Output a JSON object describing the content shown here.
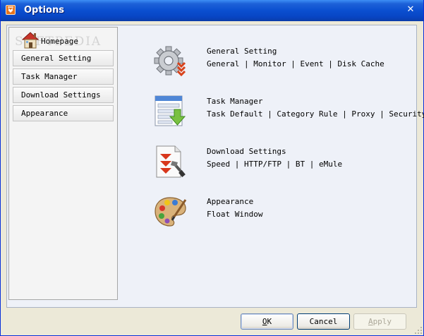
{
  "window": {
    "title": "Options"
  },
  "watermark": "SOFTPEDIA",
  "sidebar": {
    "home": {
      "label": "Homepage",
      "icon": "house-icon"
    },
    "items": [
      {
        "label": "General Setting"
      },
      {
        "label": "Task Manager"
      },
      {
        "label": "Download Settings"
      },
      {
        "label": "Appearance"
      }
    ]
  },
  "sections": [
    {
      "title": "General Setting",
      "icon": "gear-icon",
      "links": [
        "General",
        "Monitor",
        "Event",
        "Disk Cache"
      ]
    },
    {
      "title": "Task Manager",
      "icon": "task-list-icon",
      "links": [
        "Task Default",
        "Category Rule",
        "Proxy",
        "Security"
      ]
    },
    {
      "title": "Download Settings",
      "icon": "download-tools-icon",
      "links": [
        "Speed",
        "HTTP/FTP",
        "BT",
        "eMule"
      ]
    },
    {
      "title": "Appearance",
      "icon": "palette-icon",
      "links": [
        "Float Window"
      ]
    }
  ],
  "separator": "|",
  "buttons": {
    "ok": {
      "label": "OK",
      "mnemonic": "O",
      "rest": "K"
    },
    "cancel": {
      "label": "Cancel"
    },
    "apply": {
      "label": "Apply",
      "mnemonic": "A",
      "rest": "pply",
      "enabled": false
    }
  },
  "colors": {
    "title_bar": "#0a4fd0",
    "accent_orange": "#e8731a",
    "client_bg": "#eef1f8"
  }
}
